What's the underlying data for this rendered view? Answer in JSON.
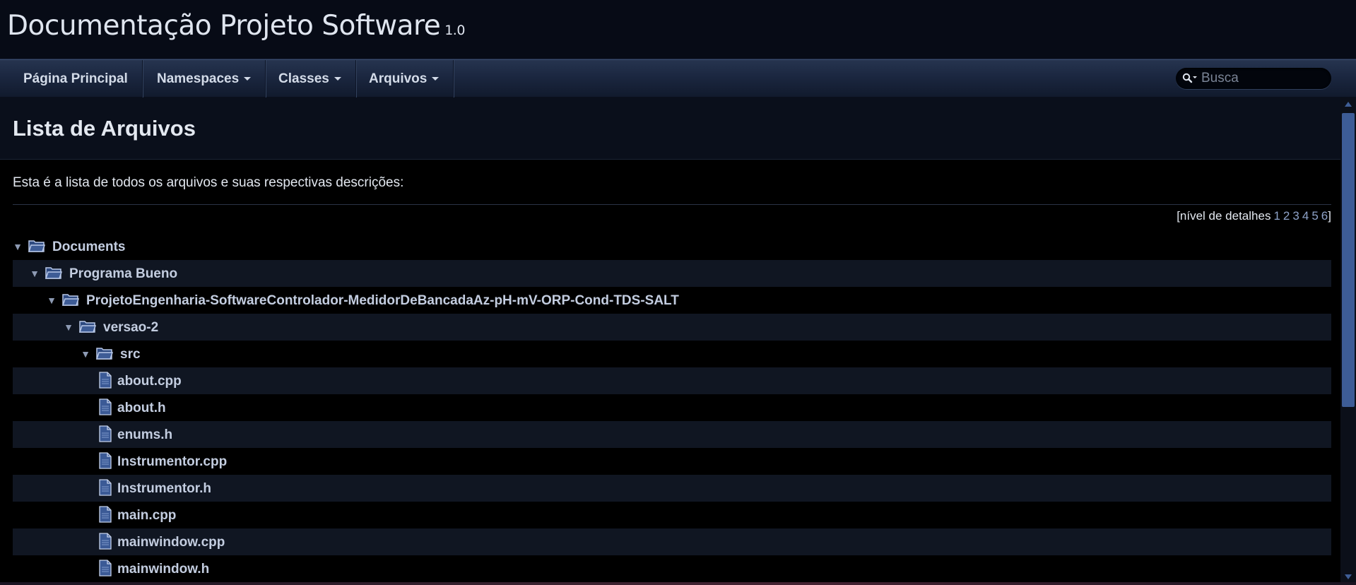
{
  "header": {
    "project_name": "Documentação Projeto Software",
    "project_number": "1.0"
  },
  "nav": {
    "items": [
      {
        "label": "Página Principal",
        "has_menu": false
      },
      {
        "label": "Namespaces",
        "has_menu": true
      },
      {
        "label": "Classes",
        "has_menu": true
      },
      {
        "label": "Arquivos",
        "has_menu": true
      }
    ],
    "search": {
      "placeholder": "Busca",
      "value": ""
    }
  },
  "page": {
    "title": "Lista de Arquivos",
    "intro": "Esta é a lista de todos os arquivos e suas respectivas descrições:",
    "detail_levels": {
      "label": "[nível de detalhes",
      "levels": [
        "1",
        "2",
        "3",
        "4",
        "5",
        "6"
      ],
      "close": "]"
    }
  },
  "tree": [
    {
      "type": "folder",
      "name": "Documents",
      "depth": 0
    },
    {
      "type": "folder",
      "name": "Programa Bueno",
      "depth": 1
    },
    {
      "type": "folder",
      "name": "ProjetoEngenharia-SoftwareControlador-MedidorDeBancadaAz-pH-mV-ORP-Cond-TDS-SALT",
      "depth": 2
    },
    {
      "type": "folder",
      "name": "versao-2",
      "depth": 3
    },
    {
      "type": "folder",
      "name": "src",
      "depth": 4
    },
    {
      "type": "file",
      "name": "about.cpp",
      "depth": 5
    },
    {
      "type": "file",
      "name": "about.h",
      "depth": 5
    },
    {
      "type": "file",
      "name": "enums.h",
      "depth": 5
    },
    {
      "type": "file",
      "name": "Instrumentor.cpp",
      "depth": 5
    },
    {
      "type": "file",
      "name": "Instrumentor.h",
      "depth": 5
    },
    {
      "type": "file",
      "name": "main.cpp",
      "depth": 5
    },
    {
      "type": "file",
      "name": "mainwindow.cpp",
      "depth": 5
    },
    {
      "type": "file",
      "name": "mainwindow.h",
      "depth": 5
    }
  ],
  "colors": {
    "background": "#000000",
    "nav": "#1b2740",
    "link": "#c3cde0",
    "accent": "#3d5c96"
  }
}
